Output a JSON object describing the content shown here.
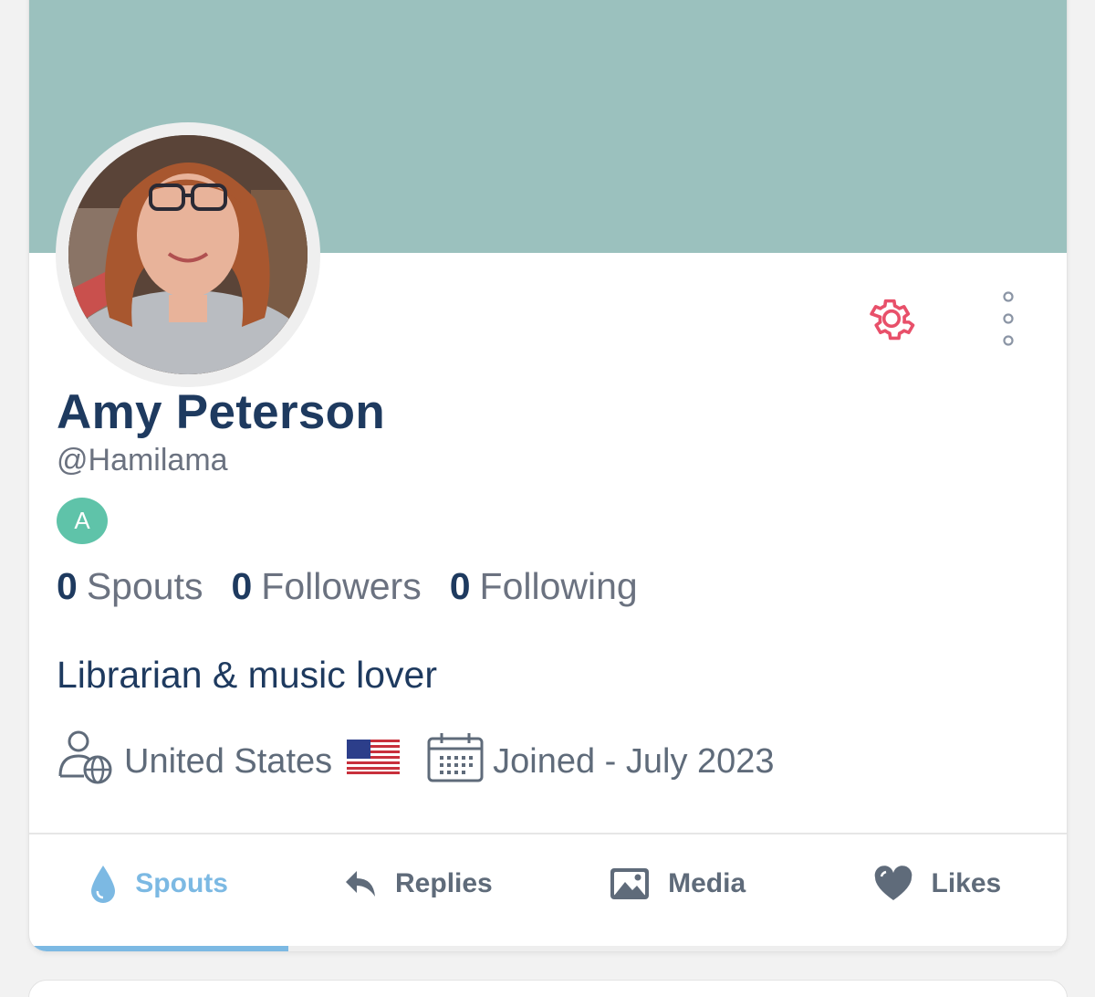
{
  "profile": {
    "name": "Amy Peterson",
    "handle": "@Hamilama",
    "badge": "A",
    "bio": "Librarian & music lover",
    "location": "United States",
    "joined": "Joined - July 2023"
  },
  "stats": [
    {
      "count": "0",
      "label": "Spouts"
    },
    {
      "count": "0",
      "label": "Followers"
    },
    {
      "count": "0",
      "label": "Following"
    }
  ],
  "tabs": [
    {
      "label": "Spouts",
      "icon": "droplet-icon",
      "active": true
    },
    {
      "label": "Replies",
      "icon": "reply-arrow-icon",
      "active": false
    },
    {
      "label": "Media",
      "icon": "image-icon",
      "active": false
    },
    {
      "label": "Likes",
      "icon": "heart-icon",
      "active": false
    }
  ],
  "colors": {
    "banner": "#9bc1be",
    "accent": "#7cb9e3",
    "name": "#1e3a5f",
    "settings": "#e8506a",
    "badge": "#5fc3a9"
  }
}
